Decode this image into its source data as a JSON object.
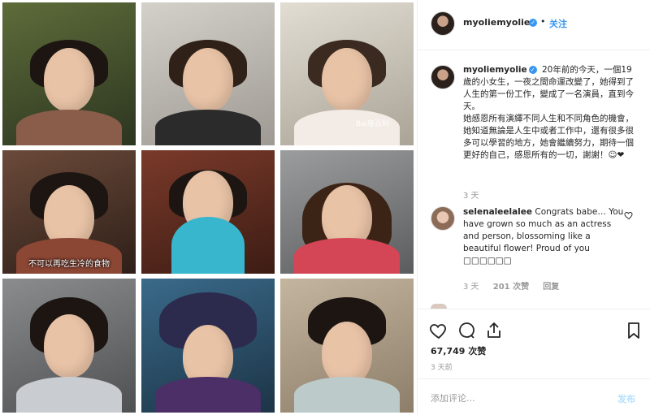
{
  "grid": {
    "tiles": [
      {
        "caption": "",
        "bg": "#3f4a2a",
        "body": "#6e4a3c"
      },
      {
        "caption": "",
        "bg": "#b9b4ae",
        "body": "#2b2b2b"
      },
      {
        "caption": "",
        "bg": "#c9c3b7",
        "body": "#efe7e0"
      },
      {
        "caption": "",
        "bg": "#4a3328",
        "body": "#7c3a2e"
      },
      {
        "caption": "",
        "bg": "#5b2b20",
        "body": "#3db3c9"
      },
      {
        "caption": "",
        "bg": "#7e7f80",
        "body": "#d14052"
      },
      {
        "caption": "",
        "bg": "#686a6c",
        "body": "#c8ccd0"
      },
      {
        "caption": "",
        "bg": "#2a4a63",
        "body": "#4a2f63"
      },
      {
        "caption": "",
        "bg": "#b3a48f",
        "body": "#b9c7c8"
      }
    ],
    "subtitle": "不可以再吃生冷的食物",
    "watermark": "Bai度百科"
  },
  "header": {
    "username": "myoliemyolie",
    "verified_glyph": "✓",
    "dot": "•",
    "follow_label": "关注"
  },
  "caption": {
    "username": "myoliemyolie",
    "verified_glyph": "✓",
    "text1": "20年前的今天，一個19歲的小女生，一夜之間命運改變了，她得到了人生的第一份工作，變成了一名演員，直到今天。",
    "text2": "她感恩所有演繹不同人生和不同角色的機會，她知道無論是人生中或者工作中，還有很多很多可以學習的地方，她會繼續努力，期待一個更好的自己，感恩所有的一切，謝謝！☺❤",
    "time": "3 天"
  },
  "comment": {
    "username": "selenaleelalee",
    "text": "Congrats babe… You have grown so much as an actress and person, blossoming like a beautiful flower! Proud of you □□□□□□",
    "time": "3 天",
    "likes": "201 次赞",
    "reply": "回复"
  },
  "actions": {
    "likes_count": "67,749 次赞",
    "date": "3 天前"
  },
  "comment_box": {
    "placeholder": "添加评论...",
    "post_label": "发布"
  },
  "colors": {
    "accent": "#3897f0",
    "post_disabled": "#b2dffc",
    "muted": "#999999"
  },
  "icons": [
    "verified-icon",
    "heart-icon",
    "comment-icon",
    "share-icon",
    "bookmark-icon"
  ]
}
